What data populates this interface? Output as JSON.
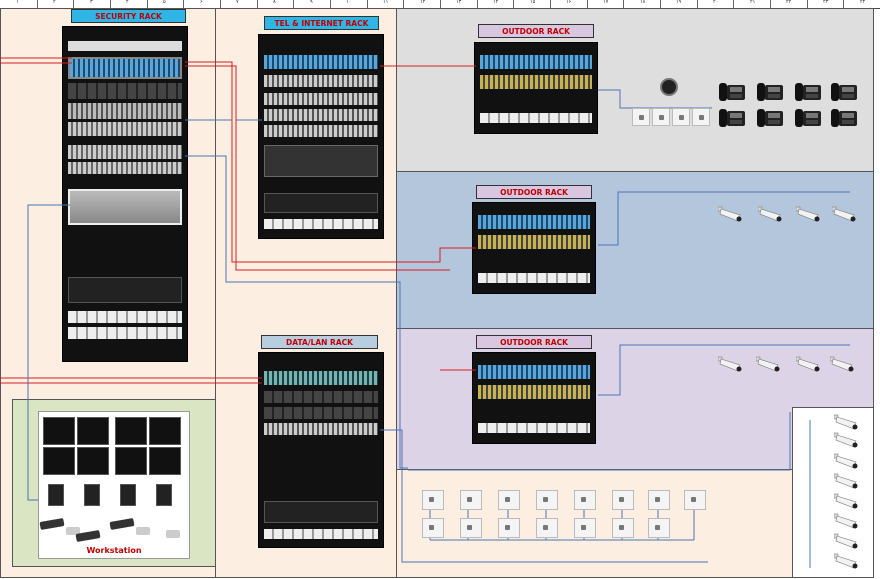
{
  "racks": {
    "security": "SECURITY RACK",
    "tel_internet": "TEL & INTERNET RACK",
    "data_lan": "DATA/LAN RACK",
    "outdoor_1": "OUTDOOR RACK",
    "outdoor_2": "OUTDOOR RACK",
    "outdoor_3": "OUTDOOR RACK"
  },
  "workstation_label": "Workstation",
  "ruler_numbers": [
    "۱",
    "۲",
    "۳",
    "۴",
    "۵",
    "۶",
    "۷",
    "۸",
    "۹",
    "۱۰",
    "۱۱",
    "۱۲",
    "۱۳",
    "۱۴",
    "۱۵",
    "۱۶",
    "۱۷",
    "۱۸",
    "۱۹",
    "۲۰",
    "۲۱",
    "۲۲",
    "۲۳",
    "۲۴"
  ],
  "colors": {
    "zone_peach": "#fdeee2",
    "zone_grey": "#dedede",
    "zone_blue": "#b4c6dc",
    "zone_purple": "#ddd3e6",
    "zone_green": "#d9e5c3",
    "label_cyan": "#2fb5e6",
    "label_lavender": "#d9c6e0",
    "label_steel": "#b9cde0",
    "wire_red": "#d22020",
    "wire_blue": "#4a74b8"
  },
  "icons": [
    "wifi-access-point-icon",
    "ip-phone-icon",
    "cctv-camera-icon",
    "network-outlet-icon",
    "monitor-icon",
    "pc-tower-icon",
    "keyboard-icon",
    "mouse-icon"
  ]
}
